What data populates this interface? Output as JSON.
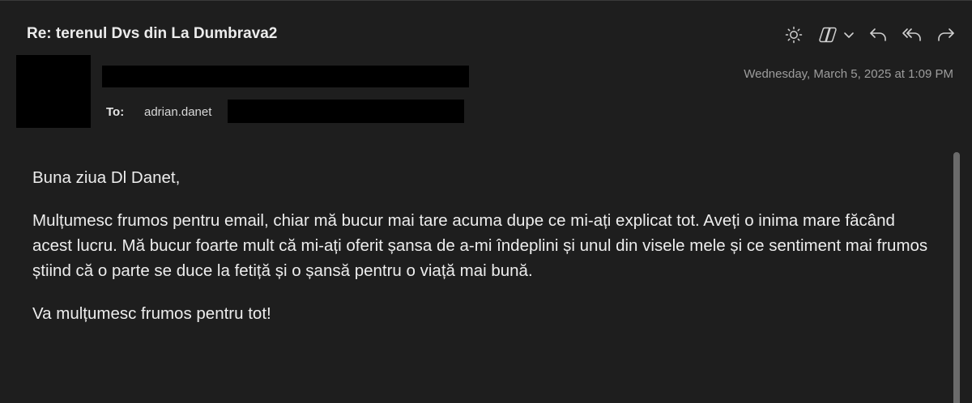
{
  "email": {
    "subject": "Re: terenul Dvs din La Dumbrava2",
    "to_label": "To:",
    "to_address": "adrian.danet",
    "date": "Wednesday, March 5, 2025 at 1:09 PM",
    "body": {
      "greeting": "Buna ziua Dl Danet,",
      "paragraph": "Mulțumesc frumos pentru email, chiar mă bucur mai tare acuma dupe ce mi-ați explicat tot. Aveți o inima mare făcând acest lucru. Mă bucur foarte mult că mi-ați oferit șansa de a-mi îndeplini și unul din visele mele și ce sentiment mai frumos știind că o parte se duce la fetiță și o șansă pentru o viață mai bună.",
      "closing": "Va mulțumesc frumos pentru tot!"
    }
  },
  "toolbar": {
    "icons": [
      "brightness-icon",
      "copilot-icon",
      "chevron-down-icon",
      "reply-icon",
      "reply-all-icon",
      "forward-icon"
    ]
  },
  "colors": {
    "background": "#1e1e1e",
    "text": "#ededed",
    "muted": "#9d9d9d",
    "redaction": "#000000"
  }
}
